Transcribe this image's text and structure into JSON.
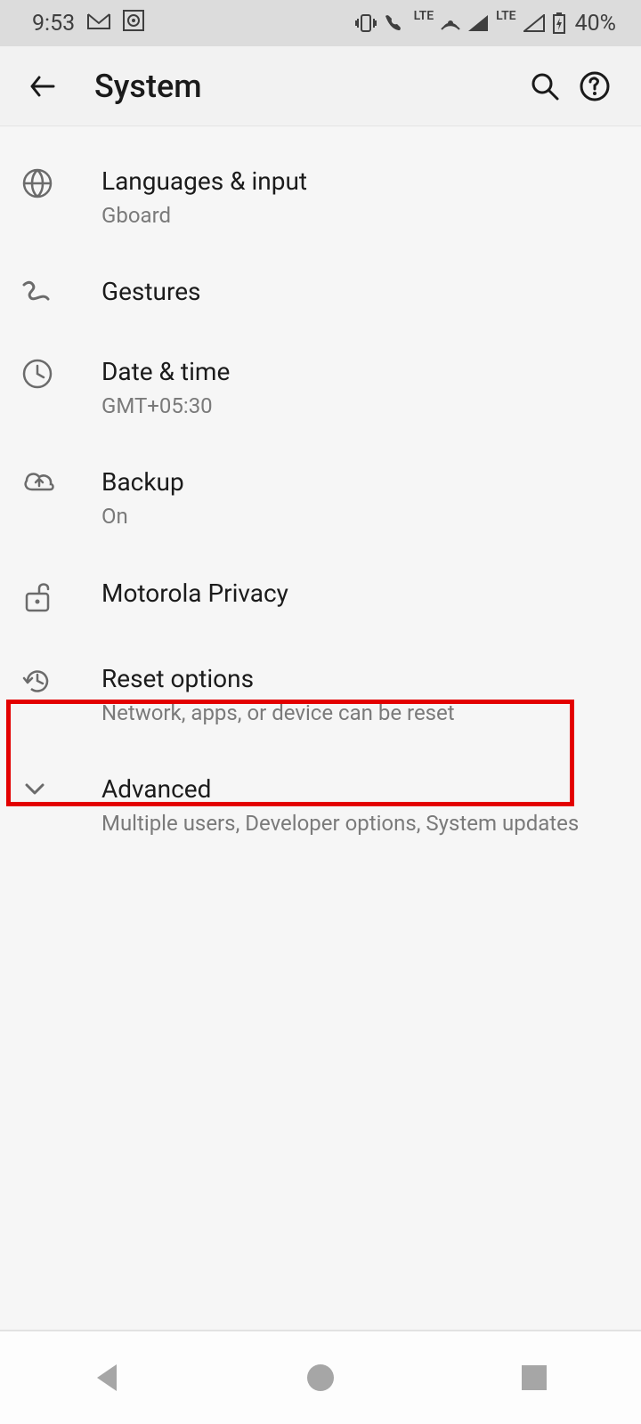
{
  "status": {
    "time": "9:53",
    "battery_pct": "40%",
    "lte": "LTE"
  },
  "appbar": {
    "title": "System"
  },
  "items": [
    {
      "title": "Languages & input",
      "sub": "Gboard"
    },
    {
      "title": "Gestures",
      "sub": ""
    },
    {
      "title": "Date & time",
      "sub": "GMT+05:30"
    },
    {
      "title": "Backup",
      "sub": "On"
    },
    {
      "title": "Motorola Privacy",
      "sub": ""
    },
    {
      "title": "Reset options",
      "sub": "Network, apps, or device can be reset"
    },
    {
      "title": "Advanced",
      "sub": "Multiple users, Developer options, System updates"
    }
  ]
}
